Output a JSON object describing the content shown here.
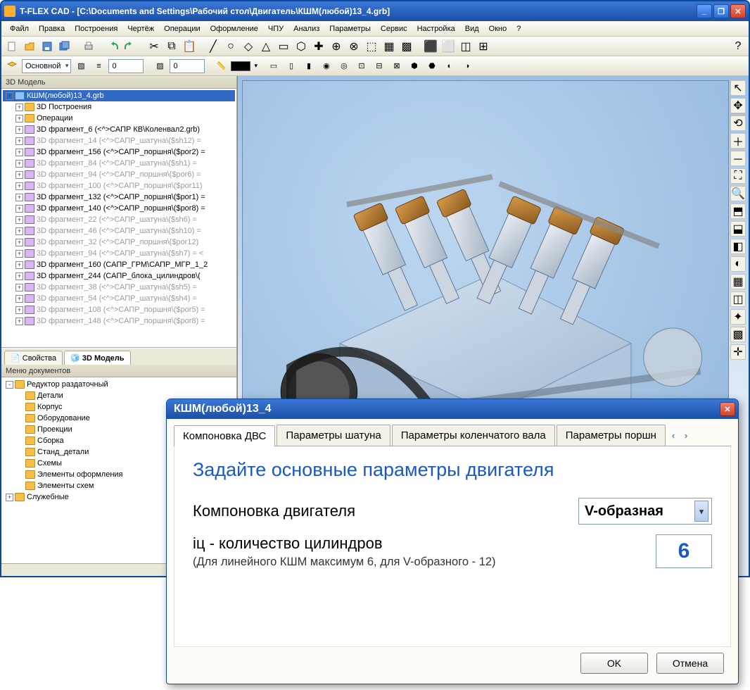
{
  "app": {
    "title": "T-FLEX CAD - [C:\\Documents and Settings\\Рабочий стол\\Двигатель\\КШМ(любой)13_4.grb]"
  },
  "menu": [
    "Файл",
    "Правка",
    "Построения",
    "Чертёж",
    "Операции",
    "Оформление",
    "ЧПУ",
    "Анализ",
    "Параметры",
    "Сервис",
    "Настройка",
    "Вид",
    "Окно",
    "?"
  ],
  "toolbar2": {
    "layer_combo": "Основной",
    "spin1": "0",
    "spin2": "0"
  },
  "panels": {
    "model_title": "3D Модель",
    "tabs": {
      "props": "Свойства",
      "model": "3D Модель"
    },
    "docmenu_title": "Меню документов"
  },
  "tree": [
    {
      "lvl": 0,
      "t": "+",
      "ico": "cube",
      "label": "КШМ(любой)13_4.grb",
      "sel": true
    },
    {
      "lvl": 1,
      "t": "+",
      "ico": "folder",
      "label": "3D Построения"
    },
    {
      "lvl": 1,
      "t": "+",
      "ico": "folder",
      "label": "Операции"
    },
    {
      "lvl": 1,
      "t": "+",
      "ico": "frag",
      "label": "3D фрагмент_6 (<^>САПР КВ\\Коленвал2.grb)"
    },
    {
      "lvl": 1,
      "t": "+",
      "ico": "frag",
      "label": "3D фрагмент_14 (<^>САПР_шатуна\\($sh12) =",
      "dim": true
    },
    {
      "lvl": 1,
      "t": "+",
      "ico": "frag",
      "label": "3D фрагмент_156 (<^>САПР_поршня\\($por2) ="
    },
    {
      "lvl": 1,
      "t": "+",
      "ico": "frag",
      "label": "3D фрагмент_84 (<^>САПР_шатуна\\($sh1) =",
      "dim": true
    },
    {
      "lvl": 1,
      "t": "+",
      "ico": "frag",
      "label": "3D фрагмент_94 (<^>САПР_поршня\\($por6) =",
      "dim": true
    },
    {
      "lvl": 1,
      "t": "+",
      "ico": "frag",
      "label": "3D фрагмент_100 (<^>САПР_поршня\\($por11)",
      "dim": true
    },
    {
      "lvl": 1,
      "t": "+",
      "ico": "frag",
      "label": "3D фрагмент_132 (<^>САПР_поршня\\($por1) ="
    },
    {
      "lvl": 1,
      "t": "+",
      "ico": "frag",
      "label": "3D фрагмент_140 (<^>САПР_поршня\\($por8) ="
    },
    {
      "lvl": 1,
      "t": "+",
      "ico": "frag",
      "label": "3D фрагмент_22 (<^>САПР_шатуна\\($sh6) =",
      "dim": true
    },
    {
      "lvl": 1,
      "t": "+",
      "ico": "frag",
      "label": "3D фрагмент_46 (<^>САПР_шатуна\\($sh10) =",
      "dim": true
    },
    {
      "lvl": 1,
      "t": "+",
      "ico": "frag",
      "label": "3D фрагмент_32 (<^>САПР_поршня\\($por12)",
      "dim": true
    },
    {
      "lvl": 1,
      "t": "+",
      "ico": "frag",
      "label": "3D фрагмент_94 (<^>САПР_шатуна\\($sh7) = <",
      "dim": true
    },
    {
      "lvl": 1,
      "t": "+",
      "ico": "frag",
      "label": "3D фрагмент_160 (САПР_ГРМ\\САПР_МГР_1_2"
    },
    {
      "lvl": 1,
      "t": "+",
      "ico": "frag",
      "label": "3D фрагмент_244 (САПР_блока_цилиндров\\("
    },
    {
      "lvl": 1,
      "t": "+",
      "ico": "frag",
      "label": "3D фрагмент_38 (<^>САПР_шатуна\\($sh5) =",
      "dim": true
    },
    {
      "lvl": 1,
      "t": "+",
      "ico": "frag",
      "label": "3D фрагмент_54 (<^>САПР_шатуна\\($sh4) =",
      "dim": true
    },
    {
      "lvl": 1,
      "t": "+",
      "ico": "frag",
      "label": "3D фрагмент_108 (<^>САПР_поршня\\($por5) =",
      "dim": true
    },
    {
      "lvl": 1,
      "t": "+",
      "ico": "frag",
      "label": "3D фрагмент_148 (<^>САПР_поршня\\($por8) =",
      "dim": true
    }
  ],
  "docmenu": [
    {
      "lvl": 0,
      "t": "-",
      "ico": "folder",
      "label": "Редуктор раздаточный"
    },
    {
      "lvl": 1,
      "t": "",
      "ico": "folder",
      "label": "Детали"
    },
    {
      "lvl": 1,
      "t": "",
      "ico": "folder",
      "label": "Корпус"
    },
    {
      "lvl": 1,
      "t": "",
      "ico": "folder",
      "label": "Оборудование"
    },
    {
      "lvl": 1,
      "t": "",
      "ico": "folder",
      "label": "Проекции"
    },
    {
      "lvl": 1,
      "t": "",
      "ico": "folder",
      "label": "Сборка"
    },
    {
      "lvl": 1,
      "t": "",
      "ico": "folder",
      "label": "Станд_детали"
    },
    {
      "lvl": 1,
      "t": "",
      "ico": "folder",
      "label": "Схемы"
    },
    {
      "lvl": 1,
      "t": "",
      "ico": "folder",
      "label": "Элементы оформления"
    },
    {
      "lvl": 1,
      "t": "",
      "ico": "folder",
      "label": "Элементы схем"
    },
    {
      "lvl": 0,
      "t": "+",
      "ico": "folder",
      "label": "Служебные"
    }
  ],
  "dialog": {
    "title": "КШМ(любой)13_4",
    "tabs": [
      "Компоновка ДВС",
      "Параметры шатуна",
      "Параметры коленчатого вала",
      "Параметры поршн"
    ],
    "active_tab": 0,
    "heading": "Задайте основные параметры двигателя",
    "param1_label": "Компоновка двигателя",
    "param1_value": "V-образная",
    "param2_label": "iц  - количество цилиндров",
    "param2_hint": "(Для линейного КШМ максимум 6, для V-образного - 12)",
    "param2_value": "6",
    "ok": "OK",
    "cancel": "Отмена"
  }
}
